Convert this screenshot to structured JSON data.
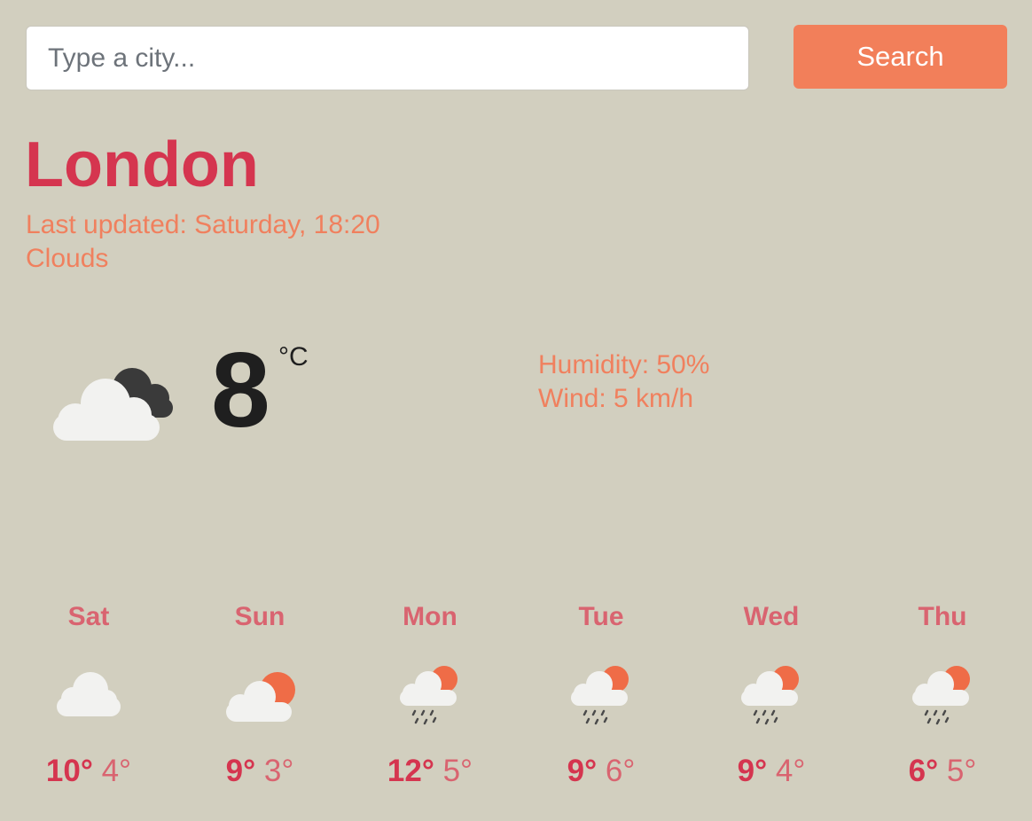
{
  "search": {
    "placeholder": "Type a city...",
    "button_label": "Search"
  },
  "current": {
    "city": "London",
    "last_updated": "Last updated: Saturday, 18:20",
    "condition": "Clouds",
    "icon": "broken-clouds-icon",
    "temperature": "8",
    "unit": "°C",
    "humidity": "Humidity: 50%",
    "wind": "Wind: 5 km/h"
  },
  "colors": {
    "background": "#d2cfbf",
    "accent": "#f27f5a",
    "city": "#d5354f",
    "day_label": "#d96470"
  },
  "forecast": [
    {
      "day": "Sat",
      "max": "10°",
      "min": "4°",
      "icon": "cloud-icon"
    },
    {
      "day": "Sun",
      "max": "9°",
      "min": "3°",
      "icon": "sun-behind-cloud-icon"
    },
    {
      "day": "Mon",
      "max": "12°",
      "min": "5°",
      "icon": "rain-sun-cloud-icon"
    },
    {
      "day": "Tue",
      "max": "9°",
      "min": "6°",
      "icon": "rain-sun-cloud-icon"
    },
    {
      "day": "Wed",
      "max": "9°",
      "min": "4°",
      "icon": "rain-sun-cloud-icon"
    },
    {
      "day": "Thu",
      "max": "6°",
      "min": "5°",
      "icon": "rain-sun-cloud-icon"
    }
  ]
}
